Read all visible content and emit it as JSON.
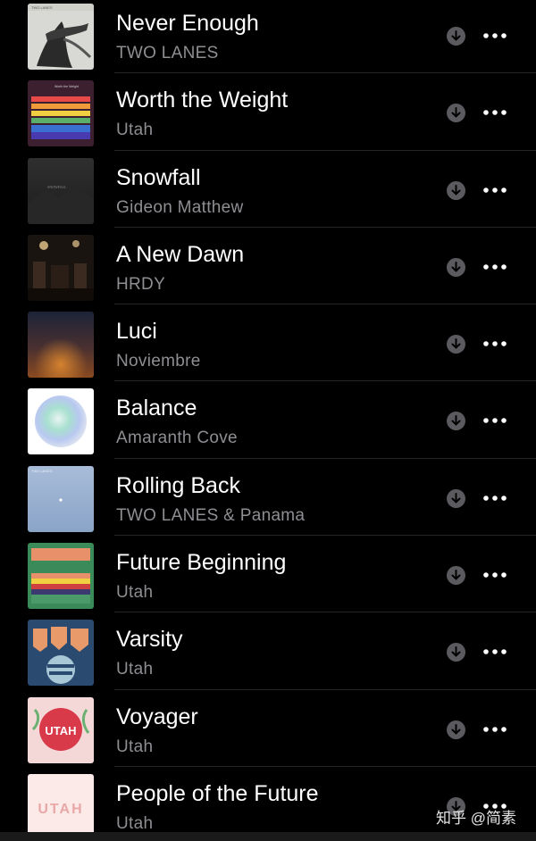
{
  "tracks": [
    {
      "title": "Never Enough",
      "artist": "TWO LANES",
      "art": "never-enough-art",
      "art_label": "TWO LANES"
    },
    {
      "title": "Worth the Weight",
      "artist": "Utah",
      "art": "worth-the-weight-art",
      "art_label": "Worth the Weight"
    },
    {
      "title": "Snowfall",
      "artist": "Gideon Matthew",
      "art": "snowfall-art",
      "art_label": "SNOWFALL"
    },
    {
      "title": "A New Dawn",
      "artist": "HRDY",
      "art": "a-new-dawn-art"
    },
    {
      "title": "Luci",
      "artist": "Noviembre",
      "art": "luci-art"
    },
    {
      "title": "Balance",
      "artist": "Amaranth Cove",
      "art": "balance-art"
    },
    {
      "title": "Rolling Back",
      "artist": "TWO LANES & Panama",
      "art": "rolling-back-art",
      "art_label": "TWO LANES"
    },
    {
      "title": "Future Beginning",
      "artist": "Utah",
      "art": "future-beginning-art"
    },
    {
      "title": "Varsity",
      "artist": "Utah",
      "art": "varsity-art"
    },
    {
      "title": "Voyager",
      "artist": "Utah",
      "art": "voyager-art",
      "art_label": "UTAH"
    },
    {
      "title": "People of the Future",
      "artist": "Utah",
      "art": "people-of-the-future-art",
      "art_label": "UTAH"
    }
  ],
  "icons": {
    "download": "download-icon",
    "more": "more-options-icon"
  },
  "colors": {
    "background": "#000000",
    "title": "#ffffff",
    "artist": "#8e8e93",
    "icon": "#5b5b5f"
  },
  "watermark": "知乎 @简素"
}
